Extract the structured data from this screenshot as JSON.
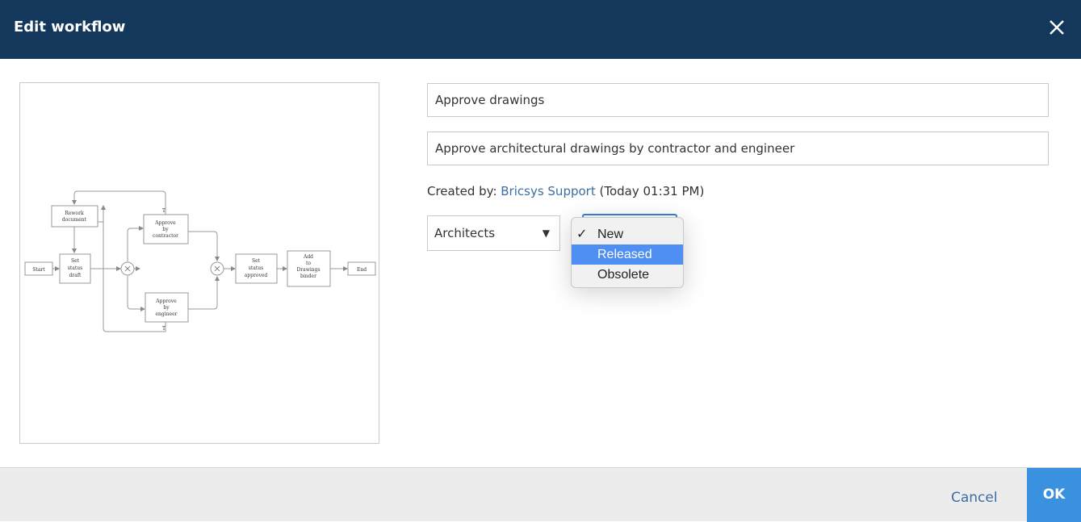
{
  "dialog": {
    "title": "Edit workflow",
    "close_icon": "close-icon"
  },
  "form": {
    "name_value": "Approve drawings",
    "description_value": "Approve architectural drawings by contractor and engineer",
    "created_prefix": "Created by: ",
    "created_user": "Bricsys Support",
    "created_time": " (Today 01:31 PM)",
    "group_select": {
      "value": "Architects",
      "arrow": "▼"
    },
    "status_select": {
      "options": [
        "New",
        "Released",
        "Obsolete"
      ],
      "selected": "New",
      "highlighted": "Released",
      "check": "✓"
    }
  },
  "diagram": {
    "nodes": {
      "start": "Start",
      "set_draft": [
        "Set",
        "status",
        "draft"
      ],
      "rework": [
        "Rework",
        "document"
      ],
      "approve_contractor": [
        "Approve",
        "by",
        "contractor"
      ],
      "approve_engineer": [
        "Approve",
        "by",
        "engineer"
      ],
      "set_approved": [
        "Set",
        "status",
        "approved"
      ],
      "add_binder": [
        "Add",
        "to",
        "Drawings",
        "binder"
      ],
      "end": "End"
    },
    "labels": {
      "t1": "T",
      "t2": "T"
    }
  },
  "footer": {
    "cancel_label": "Cancel",
    "ok_label": "OK"
  },
  "colors": {
    "header_bg": "#13385c",
    "ok_bg": "#3a91e0",
    "link": "#3a6ea5",
    "menu_highlight": "#4f8ef2"
  }
}
